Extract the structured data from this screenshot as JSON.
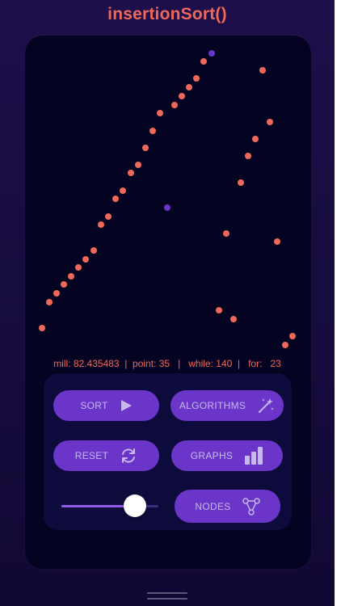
{
  "app": {
    "title": "insertionSort()"
  },
  "stats": {
    "mill_label": "mill:",
    "mill_value": "82.435483",
    "point_label": "point:",
    "point_value": "35",
    "while_label": "while:",
    "while_value": "140",
    "for_label": "for:",
    "for_value": "23"
  },
  "buttons": {
    "sort": "SORT",
    "algorithms": "ALGORITHMS",
    "reset": "RESET",
    "graphs": "GRAPHS",
    "nodes": "NODES"
  },
  "speed_slider": {
    "value": 0.73
  },
  "colors": {
    "accent": "#f0685a",
    "highlight": "#6a35c8",
    "button": "#6a35c8",
    "card": "#040322",
    "panel": "#0c0b3c"
  },
  "icons": {
    "sort": "play-icon",
    "algorithms": "magic-wand-icon",
    "reset": "refresh-icon",
    "graphs": "bar-chart-icon",
    "nodes": "graph-nodes-icon"
  }
}
